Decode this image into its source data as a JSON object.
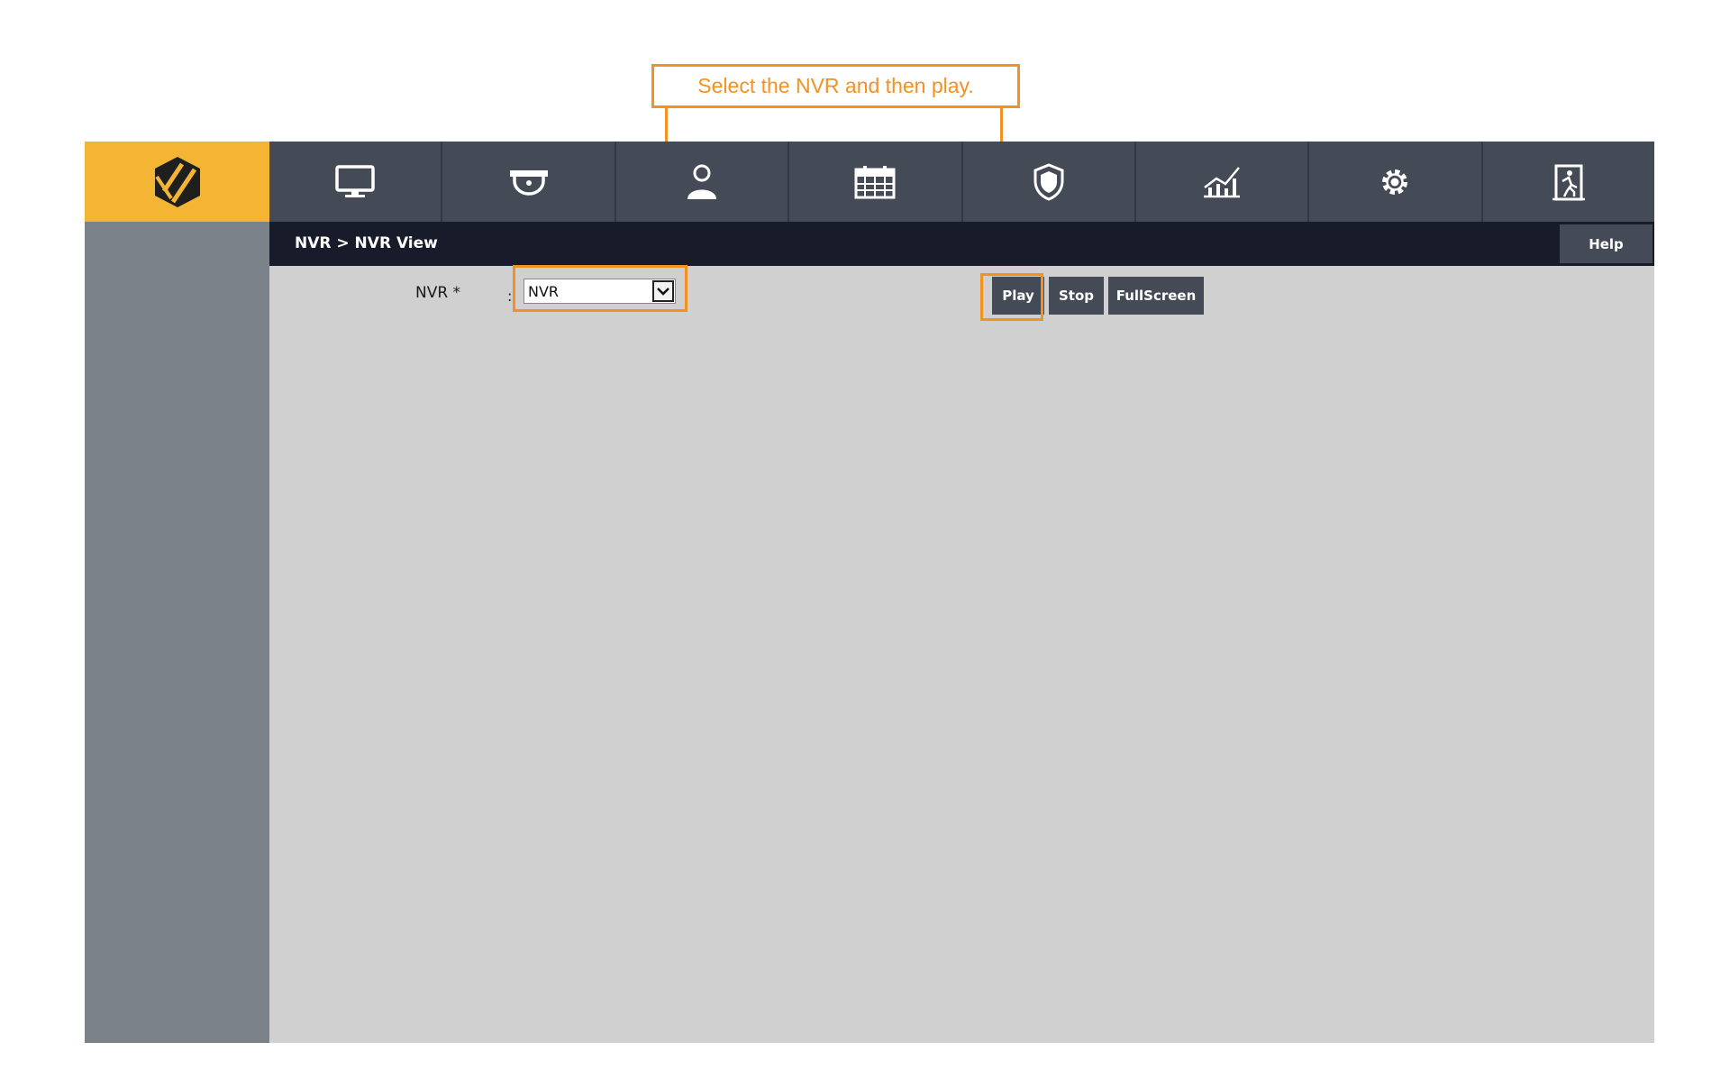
{
  "annotation": {
    "callout_text": "Select the NVR and then play.",
    "accent_color": "#f39121"
  },
  "nav": {
    "items": [
      {
        "icon": "monitor-icon"
      },
      {
        "icon": "dome-camera-icon"
      },
      {
        "icon": "user-icon"
      },
      {
        "icon": "calendar-icon"
      },
      {
        "icon": "shield-icon"
      },
      {
        "icon": "chart-icon"
      },
      {
        "icon": "gear-icon"
      },
      {
        "icon": "exit-door-icon"
      }
    ]
  },
  "header": {
    "breadcrumb": "NVR > NVR View",
    "help_label": "Help"
  },
  "form": {
    "nvr_label": "NVR *",
    "colon": ":",
    "nvr_selected": "NVR"
  },
  "controls": {
    "play_label": "Play",
    "stop_label": "Stop",
    "fullscreen_label": "FullScreen"
  },
  "colors": {
    "brand_yellow": "#f4b535",
    "nav_bg": "#454a57",
    "breadcrumb_bg": "#181c2a",
    "sidebar_bg": "#7b8289",
    "content_bg": "#d0d0d0"
  }
}
